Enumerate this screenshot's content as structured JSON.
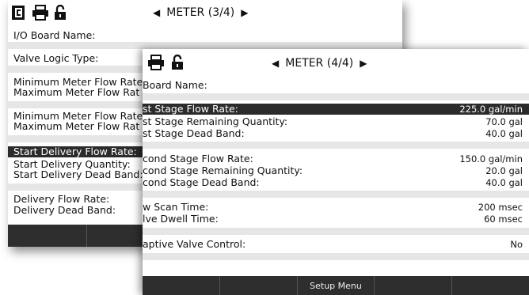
{
  "back_screen": {
    "title": "METER (3/4)",
    "nav_prev": "◀",
    "nav_next": "▶",
    "icons": [
      "document-icon",
      "printer-icon",
      "lock-icon"
    ],
    "rows": [
      {
        "label": "I/O Board Name:"
      },
      {
        "label": "Valve Logic Type:"
      },
      {
        "label": "Minimum Meter Flow Rate"
      },
      {
        "label": "Maximum Meter Flow Rat"
      },
      {
        "label": "Minimum Meter Flow Rate"
      },
      {
        "label": "Maximum Meter Flow Rat"
      },
      {
        "label": "Start Delivery Flow Rate:"
      },
      {
        "label": "Start Delivery Quantity:"
      },
      {
        "label": "Start Delivery Dead Band:"
      },
      {
        "label": "Delivery Flow Rate:"
      },
      {
        "label": "Delivery Dead Band:"
      }
    ]
  },
  "front_screen": {
    "title": "METER (4/4)",
    "nav_prev": "◀",
    "nav_next": "▶",
    "icons": [
      "printer-icon",
      "lock-icon"
    ],
    "rows": [
      {
        "label": "Board Name:",
        "value": ""
      },
      {
        "label": "st Stage Flow Rate:",
        "value": "225.0 gal/min"
      },
      {
        "label": "st Stage Remaining Quantity:",
        "value": "70.0 gal"
      },
      {
        "label": "st Stage Dead Band:",
        "value": "40.0 gal"
      },
      {
        "label": "cond Stage Flow Rate:",
        "value": "150.0 gal/min"
      },
      {
        "label": "cond Stage Remaining Quantity:",
        "value": "20.0 gal"
      },
      {
        "label": "cond Stage Dead Band:",
        "value": "40.0 gal"
      },
      {
        "label": "w Scan Time:",
        "value": "200 msec"
      },
      {
        "label": "lve Dwell Time:",
        "value": "60 msec"
      },
      {
        "label": "aptive Valve Control:",
        "value": "No"
      }
    ],
    "softkeys": [
      "",
      "",
      "Setup Menu",
      "",
      ""
    ]
  },
  "colors": {
    "selected_row": "#2b2b2b",
    "stripe": "#e6e6e6",
    "softkey_bar": "#2e2e2e"
  }
}
